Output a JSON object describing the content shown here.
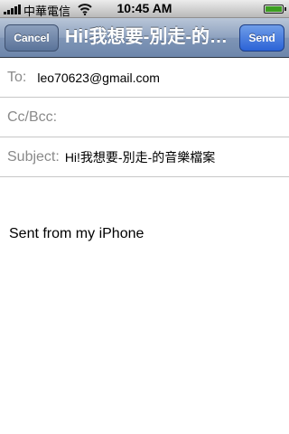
{
  "status_bar": {
    "carrier": "中華電信",
    "time": "10:45 AM",
    "signal_bars": 4,
    "battery_level": 1.0,
    "icons": [
      "signal-icon",
      "wifi-icon",
      "battery-icon"
    ]
  },
  "nav": {
    "cancel_label": "Cancel",
    "title": "Hi!我想要-別走-的音樂檔案",
    "send_label": "Send"
  },
  "fields": {
    "to_label": "To:",
    "to_value": "leo70623@gmail.com",
    "cc_label": "Cc/Bcc:",
    "subject_label": "Subject:",
    "subject_value": "Hi!我想要-別走-的音樂檔案"
  },
  "body": {
    "signature": "Sent from my iPhone"
  },
  "colors": {
    "send_button": "#2b63d6",
    "nav_bar": "#7f95b6",
    "field_label": "#8a8a8a"
  }
}
